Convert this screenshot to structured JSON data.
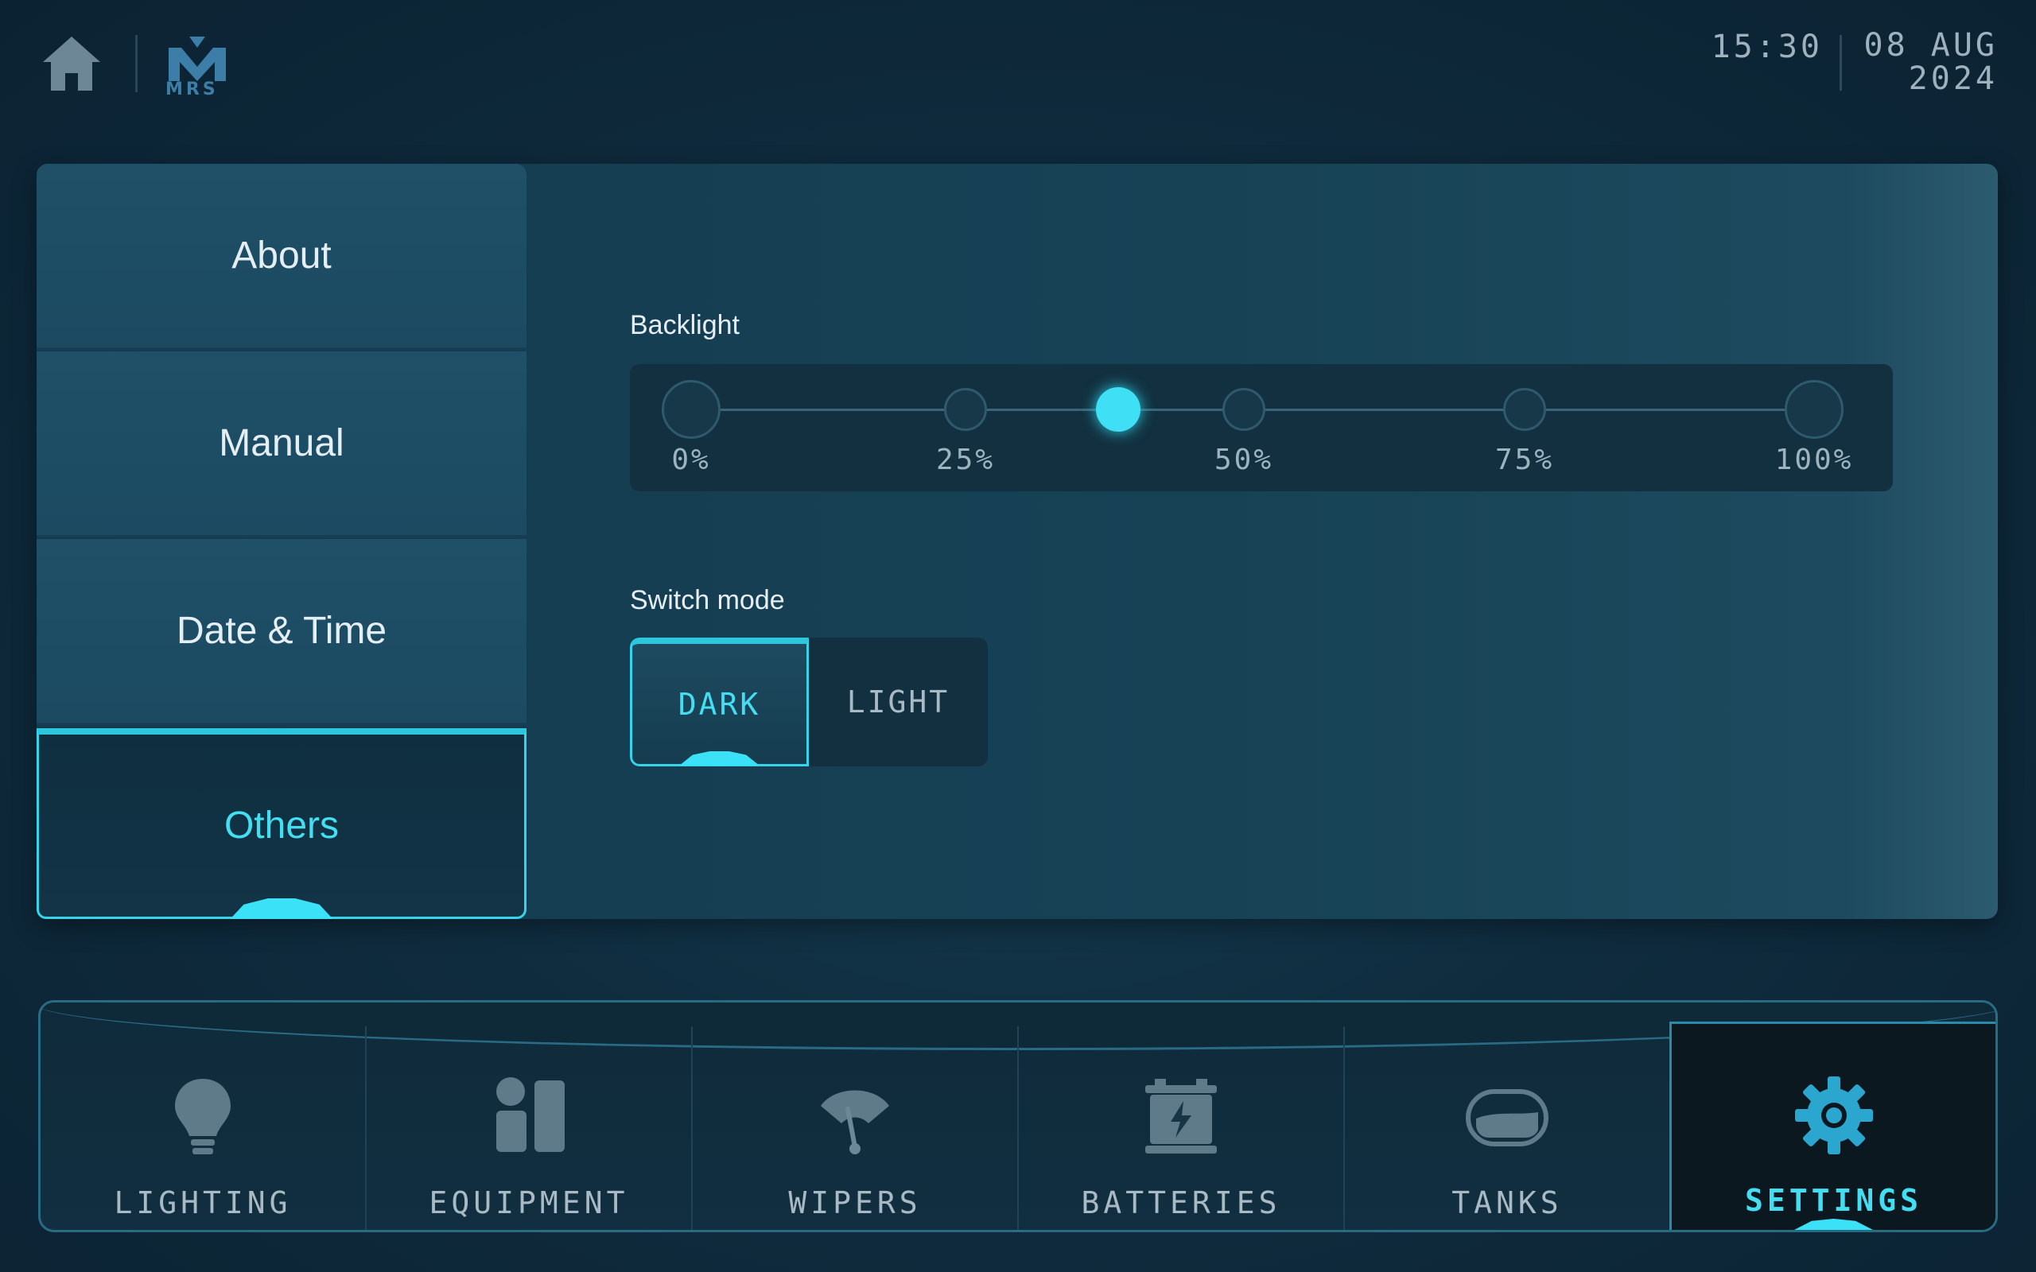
{
  "header": {
    "home_icon": "home-icon",
    "logo_text": "MRS",
    "time": "15:30",
    "date_line1": "08 AUG",
    "date_line2": "2024"
  },
  "sidebar": {
    "items": [
      {
        "label": "About",
        "active": false
      },
      {
        "label": "Manual",
        "active": false
      },
      {
        "label": "Date & Time",
        "active": false
      },
      {
        "label": "Others",
        "active": true
      }
    ]
  },
  "backlight": {
    "label": "Backlight",
    "ticks": [
      "0%",
      "25%",
      "50%",
      "75%",
      "100%"
    ],
    "value_percent": 38
  },
  "switch_mode": {
    "label": "Switch mode",
    "options": [
      "DARK",
      "LIGHT"
    ],
    "selected": "DARK"
  },
  "bottom_nav": {
    "tabs": [
      {
        "label": "LIGHTING",
        "icon": "bulb-icon"
      },
      {
        "label": "EQUIPMENT",
        "icon": "equipment-icon"
      },
      {
        "label": "WIPERS",
        "icon": "wiper-icon"
      },
      {
        "label": "BATTERIES",
        "icon": "battery-icon"
      },
      {
        "label": "TANKS",
        "icon": "tank-icon"
      },
      {
        "label": "SETTINGS",
        "icon": "gear-icon"
      }
    ],
    "active": "SETTINGS"
  },
  "colors": {
    "accent": "#3fe0f5",
    "panel": "#174256",
    "background": "#0f2c3e"
  }
}
